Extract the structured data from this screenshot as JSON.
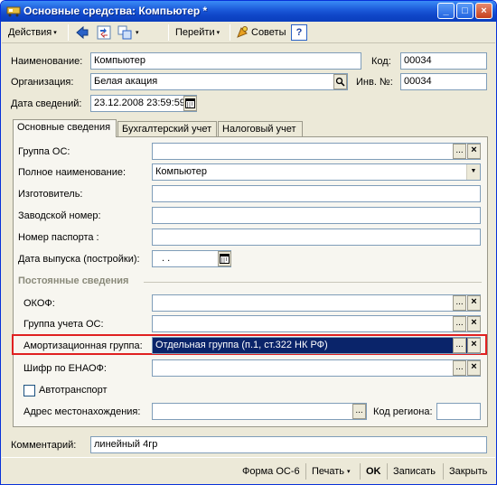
{
  "window": {
    "title": "Основные средства: Компьютер *",
    "controls": {
      "minimize": "_",
      "maximize": "□",
      "close": "×"
    }
  },
  "toolbar": {
    "actions_label": "Действия",
    "goto_label": "Перейти",
    "tips_label": "Советы",
    "help_label": "?"
  },
  "header": {
    "name_label": "Наименование:",
    "name_value": "Компьютер",
    "code_label": "Код:",
    "code_value": "00034",
    "org_label": "Организация:",
    "org_value": "Белая акация",
    "inv_label": "Инв. №:",
    "inv_value": "00034",
    "date_label": "Дата сведений:",
    "date_value": "23.12.2008 23:59:59"
  },
  "tabs": [
    {
      "label": "Основные сведения",
      "active": true
    },
    {
      "label": "Бухгалтерский учет",
      "active": false
    },
    {
      "label": "Налоговый учет",
      "active": false
    }
  ],
  "main": {
    "group_label": "Группа ОС:",
    "group_value": "",
    "fullname_label": "Полное наименование:",
    "fullname_value": "Компьютер",
    "manufacturer_label": "Изготовитель:",
    "manufacturer_value": "",
    "serial_label": "Заводской номер:",
    "serial_value": "",
    "passport_label": "Номер паспорта :",
    "passport_value": "",
    "release_label": "Дата выпуска (постройки):",
    "release_value": ". ."
  },
  "permanent": {
    "section_title": "Постоянные сведения",
    "okof_label": "ОКОФ:",
    "okof_value": "",
    "acc_group_label": "Группа учета ОС:",
    "acc_group_value": "",
    "amort_label": "Амортизационная группа:",
    "amort_value": "Отдельная группа (п.1, ст.322 НК РФ)",
    "enaof_label": "Шифр по ЕНАОФ:",
    "enaof_value": "",
    "auto_label": "Автотранспорт",
    "auto_checked": false,
    "address_label": "Адрес местонахождения:",
    "address_value": "",
    "region_label": "Код региона:",
    "region_value": ""
  },
  "comment": {
    "label": "Комментарий:",
    "value": "линейный 4гр"
  },
  "footer": {
    "form_label": "Форма ОС-6",
    "print_label": "Печать",
    "ok_label": "OK",
    "save_label": "Записать",
    "close_label": "Закрыть"
  },
  "buttons": {
    "ellipsis": "...",
    "clear": "×",
    "dropdown": "▼",
    "arrow": "▾"
  },
  "colors": {
    "accent": "#0a246a",
    "titlebar": "#0f46c8",
    "highlight_border": "#e02020"
  }
}
